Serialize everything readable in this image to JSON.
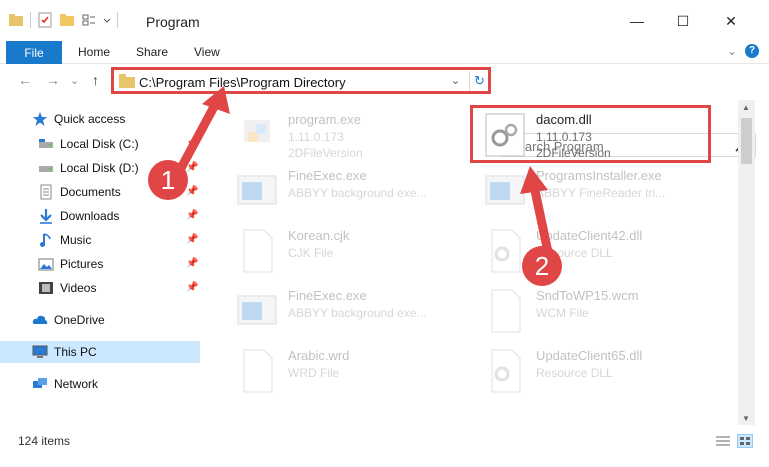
{
  "window": {
    "title": "Program",
    "minimize_glyph": "—",
    "maximize_glyph": "☐",
    "close_glyph": "✕"
  },
  "ribbon": {
    "tabs": [
      "File",
      "Home",
      "Share",
      "View"
    ],
    "expand_glyph": "⌄",
    "help_glyph": "?"
  },
  "navigation": {
    "back_glyph": "←",
    "forward_glyph": "→",
    "recent_glyph": "⌄",
    "up_glyph": "↑",
    "address": "C:\\Program Files\\Program Directory",
    "address_dropdown_glyph": "⌄",
    "refresh_glyph": "↻",
    "search_placeholder": "Search Program"
  },
  "sidebar": {
    "items": [
      {
        "label": "Quick access",
        "icon": "star-icon"
      },
      {
        "label": "Local Disk (C:)",
        "icon": "drive-icon"
      },
      {
        "label": "Local Disk (D:)",
        "icon": "drive-icon"
      },
      {
        "label": "Documents",
        "icon": "documents-icon"
      },
      {
        "label": "Downloads",
        "icon": "downloads-icon"
      },
      {
        "label": "Music",
        "icon": "music-icon"
      },
      {
        "label": "Pictures",
        "icon": "pictures-icon"
      },
      {
        "label": "Videos",
        "icon": "videos-icon"
      },
      {
        "label": "OneDrive",
        "icon": "cloud-icon"
      },
      {
        "label": "This PC",
        "icon": "computer-icon"
      },
      {
        "label": "Network",
        "icon": "network-icon"
      }
    ],
    "pin_glyph": "📌"
  },
  "files": [
    {
      "name": "program.exe",
      "line2": "1.11.0.173",
      "line3": "2DFileVersion",
      "icon": "exe-icon",
      "highlighted": false
    },
    {
      "name": "dacom.dll",
      "line2": "1.11.0.173",
      "line3": "2DFileVersion",
      "icon": "dll-gear-icon",
      "highlighted": true
    },
    {
      "name": "FineExec.exe",
      "line2": "ABBYY background exe...",
      "line3": "",
      "icon": "app-window-icon",
      "highlighted": false
    },
    {
      "name": "ProgramsInstaller.exe",
      "line2": "ABBYY FineReader tri...",
      "line3": "",
      "icon": "app-window-icon",
      "highlighted": false
    },
    {
      "name": "Korean.cjk",
      "line2": "CJK File",
      "line3": "",
      "icon": "blank-file-icon",
      "highlighted": false
    },
    {
      "name": "UpdateClient42.dll",
      "line2": "Resource DLL",
      "line3": "",
      "icon": "dll-gear-icon",
      "highlighted": false
    },
    {
      "name": "FineExec.exe",
      "line2": "ABBYY background exe...",
      "line3": "",
      "icon": "app-window-icon",
      "highlighted": false
    },
    {
      "name": "SndToWP15.wcm",
      "line2": "WCM File",
      "line3": "",
      "icon": "blank-file-icon",
      "highlighted": false
    },
    {
      "name": "Arabic.wrd",
      "line2": "WRD File",
      "line3": "",
      "icon": "blank-file-icon",
      "highlighted": false
    },
    {
      "name": "UpdateClient65.dll",
      "line2": "Resource DLL",
      "line3": "",
      "icon": "dll-gear-icon",
      "highlighted": false
    }
  ],
  "annotations": {
    "step1": "1",
    "step2": "2",
    "accent": "#e04646"
  },
  "scroll": {
    "up_glyph": "▲",
    "down_glyph": "▼"
  },
  "status": {
    "count": "124 items"
  },
  "colors": {
    "accent_blue": "#1979ca",
    "highlight_red": "#e04646",
    "selection": "#cce8ff"
  }
}
